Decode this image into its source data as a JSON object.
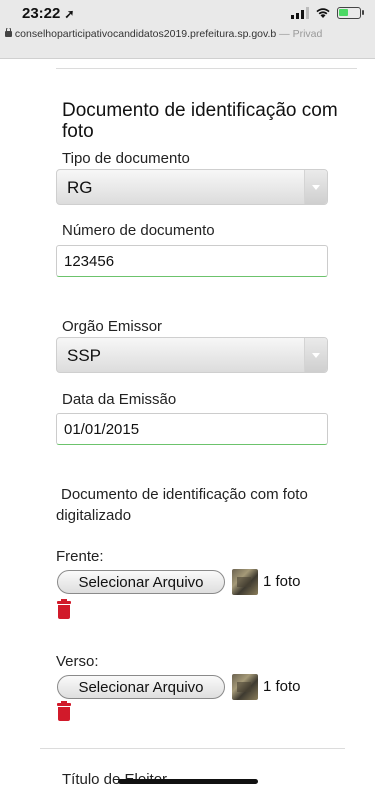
{
  "status": {
    "time": "23:22",
    "location_arrow": "➚"
  },
  "browser": {
    "url": "conselhoparticipativocandidatos2019.prefeitura.sp.gov.b",
    "url_suffix": "— Privad"
  },
  "form": {
    "section_title": "Documento de identificação com foto",
    "doc_type": {
      "label": "Tipo de documento",
      "value": "RG"
    },
    "doc_number": {
      "label": "Número de documento",
      "value": "123456"
    },
    "issuer": {
      "label": "Orgão Emissor",
      "value": "SSP"
    },
    "issue_date": {
      "label": "Data da Emissão",
      "value": "01/01/2015"
    },
    "digitized": {
      "line1": "Documento de identificação com foto",
      "line2": "digitalizado"
    },
    "front": {
      "label": "Frente:",
      "button": "Selecionar Arquivo",
      "count": "1 foto"
    },
    "back": {
      "label": "Verso:",
      "button": "Selecionar Arquivo",
      "count": "1 foto"
    },
    "next_section": "Título de Eleitor"
  }
}
